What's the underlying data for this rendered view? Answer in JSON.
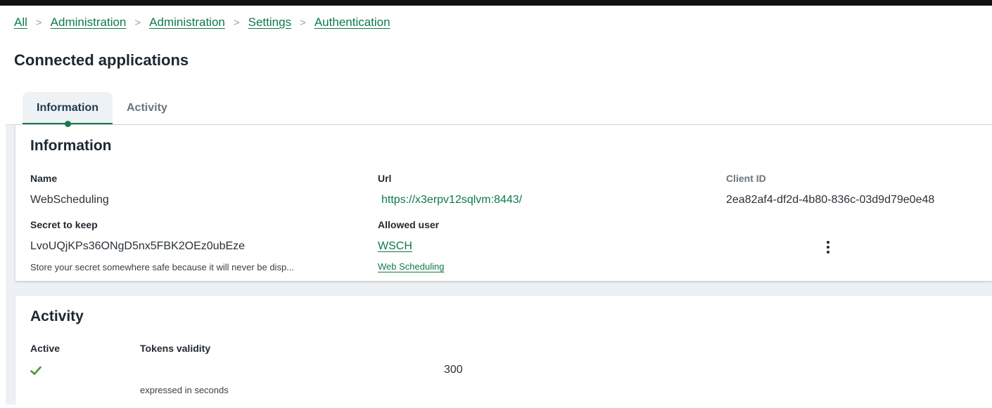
{
  "breadcrumb": {
    "items": [
      {
        "label": "All"
      },
      {
        "label": "Administration"
      },
      {
        "label": "Administration"
      },
      {
        "label": "Settings"
      },
      {
        "label": "Authentication"
      }
    ],
    "separator": ">"
  },
  "page": {
    "title": "Connected applications"
  },
  "tabs": [
    {
      "label": "Information",
      "active": true
    },
    {
      "label": "Activity",
      "active": false
    }
  ],
  "information": {
    "title": "Information",
    "name": {
      "label": "Name",
      "value": "WebScheduling"
    },
    "url": {
      "label": "Url",
      "value": "https://x3erpv12sqlvm:8443/"
    },
    "client_id": {
      "label": "Client ID",
      "value": "2ea82af4-df2d-4b80-836c-03d9d79e0e48"
    },
    "secret": {
      "label": "Secret to keep",
      "value": "LvoUQjKPs36ONgD5nx5FBK2OEz0ubEze",
      "help": "Store your secret somewhere safe because it will never be disp..."
    },
    "allowed_user": {
      "label": "Allowed user",
      "code": "WSCH",
      "name": "Web Scheduling"
    },
    "more_actions_icon": "kebab-vertical-icon"
  },
  "activity": {
    "title": "Activity",
    "active": {
      "label": "Active",
      "value": true,
      "icon": "checkmark-icon"
    },
    "tokens_validity": {
      "label": "Tokens validity",
      "value": "300",
      "help": "expressed in seconds"
    }
  },
  "colors": {
    "accent": "#18794e",
    "link": "#0e7a48",
    "topbar": "#111111",
    "content_background": "#eef1f3"
  }
}
